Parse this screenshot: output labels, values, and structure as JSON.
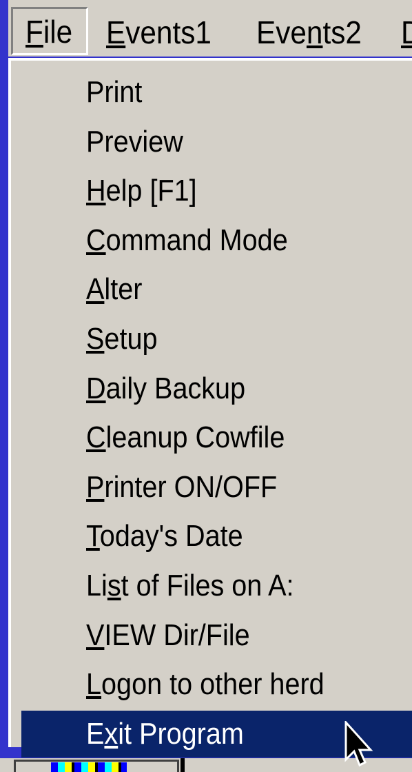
{
  "menubar": {
    "items": [
      {
        "label": "File",
        "mnemonic_index": 0
      },
      {
        "label": "Events1",
        "mnemonic_index": 0
      },
      {
        "label": "Events2",
        "mnemonic_index": 3
      },
      {
        "label": "D",
        "mnemonic_index": 0
      }
    ],
    "active_index": 0
  },
  "file_menu": {
    "items": [
      {
        "label": "Print",
        "mnemonic_index": -1
      },
      {
        "label": "Preview",
        "mnemonic_index": -1
      },
      {
        "label": "Help [F1]",
        "mnemonic_index": 0
      },
      {
        "label": "Command Mode",
        "mnemonic_index": 0
      },
      {
        "label": "Alter",
        "mnemonic_index": 0
      },
      {
        "label": "Setup",
        "mnemonic_index": 0
      },
      {
        "label": "Daily Backup",
        "mnemonic_index": 0
      },
      {
        "label": "Cleanup Cowfile",
        "mnemonic_index": 0
      },
      {
        "label": "Printer ON/OFF",
        "mnemonic_index": 0
      },
      {
        "label": "Today's Date",
        "mnemonic_index": 0
      },
      {
        "label": "List of Files on A:",
        "mnemonic_index": 2
      },
      {
        "label": "VIEW Dir/File",
        "mnemonic_index": 0
      },
      {
        "label": "Logon to other herd",
        "mnemonic_index": 0
      },
      {
        "label": "Exit Program",
        "mnemonic_index": 1
      }
    ],
    "selected_index": 13
  },
  "colors": {
    "desktop": "#3333cc",
    "face": "#d4d0c8",
    "highlight": "#0a246a",
    "highlight_text": "#ffffff"
  },
  "icons": {
    "cursor": "arrow-pointer-icon"
  }
}
